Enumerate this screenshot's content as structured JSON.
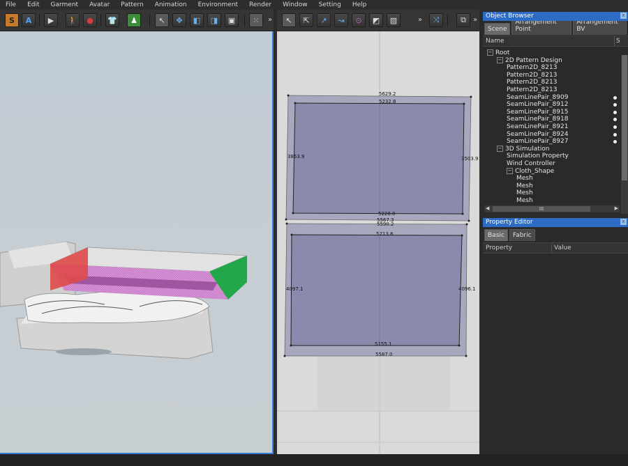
{
  "menu": [
    "File",
    "Edit",
    "Garment",
    "Avatar",
    "Pattern",
    "Animation",
    "Environment",
    "Render",
    "Window",
    "Setting",
    "Help"
  ],
  "toolbar": {
    "mode_s": "S",
    "mode_a": "A",
    "more": "»"
  },
  "pattern_dims": {
    "top": {
      "top_outer": "5629.2",
      "top_inner": "5232.8",
      "bottom_inner": "5228.0",
      "bottom_outer": "5567.3",
      "left": "3853.9",
      "right": "3503.9"
    },
    "bottom": {
      "top_outer": "5590.2",
      "top_inner": "5213.8",
      "bottom_inner": "5155.1",
      "bottom_outer": "5587.0",
      "left": "4097.1",
      "right": "4096.1"
    }
  },
  "object_browser": {
    "title": "Object Browser",
    "close": "x",
    "tabs": [
      "Scene",
      "Arrangement Point",
      "Arrangement BV"
    ],
    "column_name": "Name",
    "column_s": "S",
    "tree": [
      {
        "label": "Root",
        "level": 0,
        "exp": "−",
        "dot": false
      },
      {
        "label": "2D Pattern Design",
        "level": 1,
        "exp": "−",
        "dot": false
      },
      {
        "label": "Pattern2D_8213",
        "level": 2,
        "exp": "",
        "dot": false
      },
      {
        "label": "Pattern2D_8213",
        "level": 2,
        "exp": "",
        "dot": false
      },
      {
        "label": "Pattern2D_8213",
        "level": 2,
        "exp": "",
        "dot": false
      },
      {
        "label": "Pattern2D_8213",
        "level": 2,
        "exp": "",
        "dot": false
      },
      {
        "label": "SeamLinePair_8909",
        "level": 2,
        "exp": "",
        "dot": true
      },
      {
        "label": "SeamLinePair_8912",
        "level": 2,
        "exp": "",
        "dot": true
      },
      {
        "label": "SeamLinePair_8915",
        "level": 2,
        "exp": "",
        "dot": true
      },
      {
        "label": "SeamLinePair_8918",
        "level": 2,
        "exp": "",
        "dot": true
      },
      {
        "label": "SeamLinePair_8921",
        "level": 2,
        "exp": "",
        "dot": true
      },
      {
        "label": "SeamLinePair_8924",
        "level": 2,
        "exp": "",
        "dot": true
      },
      {
        "label": "SeamLinePair_8927",
        "level": 2,
        "exp": "",
        "dot": true
      },
      {
        "label": "3D Simulation",
        "level": 1,
        "exp": "−",
        "dot": false
      },
      {
        "label": "Simulation Property",
        "level": 2,
        "exp": "",
        "dot": false
      },
      {
        "label": "Wind Controller",
        "level": 2,
        "exp": "",
        "dot": false
      },
      {
        "label": "Cloth_Shape",
        "level": 2,
        "exp": "−",
        "dot": false
      },
      {
        "label": "Mesh",
        "level": 3,
        "exp": "",
        "dot": false
      },
      {
        "label": "Mesh",
        "level": 3,
        "exp": "",
        "dot": false
      },
      {
        "label": "Mesh",
        "level": 3,
        "exp": "",
        "dot": false
      },
      {
        "label": "Mesh",
        "level": 3,
        "exp": "",
        "dot": false
      }
    ],
    "scroll_mid": "III"
  },
  "property_editor": {
    "title": "Property Editor",
    "close": "x",
    "tabs": [
      "Basic",
      "Fabric"
    ],
    "col_property": "Property",
    "col_value": "Value"
  },
  "colors": {
    "accent": "#2d6cc4",
    "pattern_fill": "#8a8aad",
    "red_face": "#e04a4a",
    "green_face": "#22a84a"
  }
}
